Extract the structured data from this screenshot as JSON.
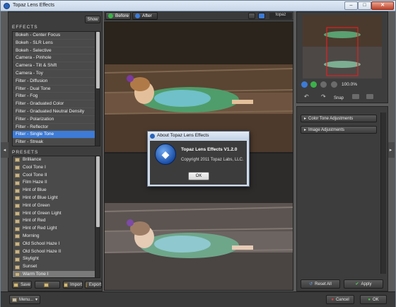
{
  "window": {
    "title": "Topaz Lens Effects",
    "minimize": "–",
    "maximize": "□",
    "close": "✕"
  },
  "effects": {
    "header": "EFFECTS",
    "show_button": "Show",
    "items": [
      "Bokeh - Center Focus",
      "Bokeh - SLR Lens",
      "Bokeh - Selective",
      "Camera - Pinhole",
      "Camera - Tilt & Shift",
      "Camera - Toy",
      "Filter - Diffusion",
      "Filter - Dual Tone",
      "Filter - Fog",
      "Filter - Graduated Color",
      "Filter - Graduated Neutral Density",
      "Filter - Polarization",
      "Filter - Reflector",
      "Filter - Single Tone",
      "Filter - Streak"
    ],
    "selected_index": 13
  },
  "presets": {
    "header": "PRESETS",
    "items": [
      "Brilliance",
      "Cool Tone I",
      "Cool Tone II",
      "Film Haze II",
      "Hint of Blue",
      "Hint of Blue Light",
      "Hint of Green",
      "Hint of Green Light",
      "Hint of Red",
      "Hint of Red Light",
      "Morning",
      "Old School Haze I",
      "Old School Haze II",
      "Skylight",
      "Sunset",
      "Warm Tone I"
    ],
    "selected_index": 15,
    "buttons": {
      "save": "Save",
      "blank": "",
      "import": "Import",
      "export": "Export"
    }
  },
  "preview": {
    "before_tab": "Before",
    "after_tab": "After",
    "logo": "topaz"
  },
  "dialog": {
    "title": "About Topaz Lens Effects",
    "product": "Topaz Lens Effects V1.2.0",
    "copyright": "Copyright 2011 Topaz Labs, LLC.",
    "ok": "OK"
  },
  "navigator": {
    "zoom_text": "100.0%",
    "snap_label": "Snap"
  },
  "adjustments": {
    "sections": [
      "Color Tone Adjustments",
      "Image Adjustments"
    ]
  },
  "footer": {
    "menu": "Menu...",
    "reset_all": "Reset All",
    "apply": "Apply",
    "cancel": "Cancel",
    "ok": "OK"
  },
  "colors": {
    "accent": "#3d7bd6",
    "panel": "#3d3d3d",
    "list_bg": "#4a4a4a",
    "selection_red": "#e02020"
  }
}
